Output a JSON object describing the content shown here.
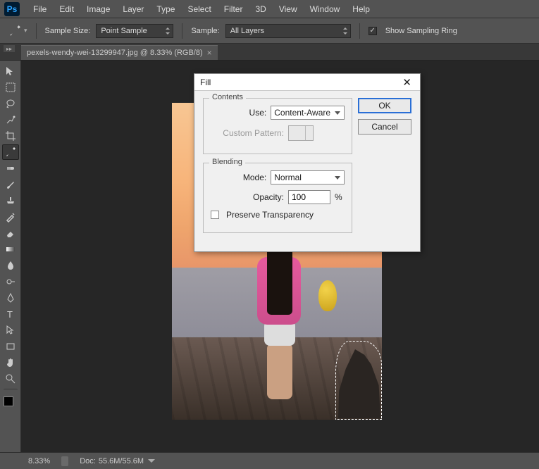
{
  "menubar": {
    "items": [
      "File",
      "Edit",
      "Image",
      "Layer",
      "Type",
      "Select",
      "Filter",
      "3D",
      "View",
      "Window",
      "Help"
    ]
  },
  "optionsbar": {
    "sampleSizeLabel": "Sample Size:",
    "sampleSizeValue": "Point Sample",
    "sampleLabel": "Sample:",
    "sampleValue": "All Layers",
    "showSamplingRingLabel": "Show Sampling Ring",
    "showSamplingRingChecked": true
  },
  "docTab": {
    "title": "pexels-wendy-wei-13299947.jpg @ 8.33% (RGB/8)"
  },
  "dialog": {
    "title": "Fill",
    "contentsLegend": "Contents",
    "useLabel": "Use:",
    "useValue": "Content-Aware",
    "customPatternLabel": "Custom Pattern:",
    "blendingLegend": "Blending",
    "modeLabel": "Mode:",
    "modeValue": "Normal",
    "opacityLabel": "Opacity:",
    "opacityValue": "100",
    "opacityUnit": "%",
    "preserveTransparencyLabel": "Preserve Transparency",
    "okLabel": "OK",
    "cancelLabel": "Cancel"
  },
  "statusbar": {
    "zoom": "8.33%",
    "docInfoLabel": "Doc:",
    "docInfoValue": "55.6M/55.6M"
  }
}
